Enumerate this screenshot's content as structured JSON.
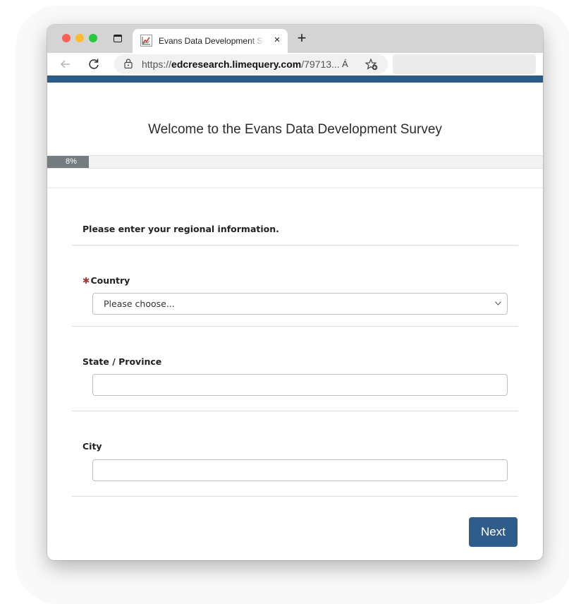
{
  "browser": {
    "tab_title": "Evans Data Development Survey",
    "tab_close": "×",
    "new_tab": "+",
    "url_prefix": "https://",
    "url_domain": "edcresearch.limequery.com",
    "url_path": "/79713...",
    "read_aloud": "Á"
  },
  "survey": {
    "title": "Welcome to the Evans Data Development Survey",
    "progress_label": "8%",
    "progress_fraction": 0.08,
    "group_description": "Please enter your regional information."
  },
  "questions": {
    "country": {
      "required_mark": "✱",
      "label": "Country",
      "selected": "Please choose..."
    },
    "state": {
      "label": "State / Province",
      "value": ""
    },
    "city": {
      "label": "City",
      "value": ""
    }
  },
  "actions": {
    "next_label": "Next"
  },
  "colors": {
    "accent": "#2d5b89",
    "required": "#a33a3a",
    "progress": "#747c80"
  }
}
